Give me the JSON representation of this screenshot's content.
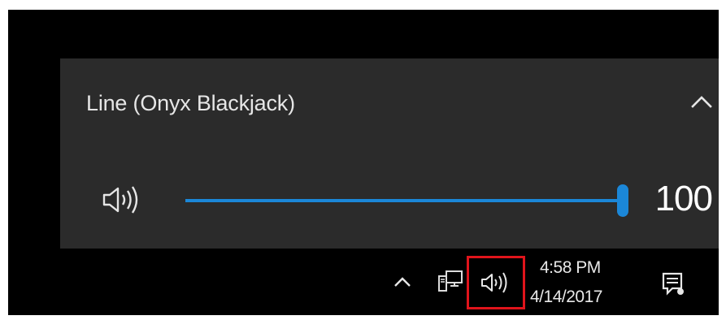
{
  "volume_flyout": {
    "device_name": "Line (Onyx Blackjack)",
    "collapse_icon": "chevron-up-icon",
    "mute_icon": "speaker-icon",
    "volume_value": "100",
    "volume_level": 1.0
  },
  "taskbar": {
    "tray_chevron_icon": "chevron-up-icon",
    "network_icon": "network-icon",
    "volume_icon": "speaker-icon",
    "clock_time": "4:58 PM",
    "clock_date": "4/14/2017",
    "action_center_icon": "notification-icon"
  },
  "colors": {
    "accent": "#1b87d8",
    "flyout_background": "#2b2b2b",
    "taskbar_background": "#000000",
    "highlight_box": "#e0141b"
  }
}
